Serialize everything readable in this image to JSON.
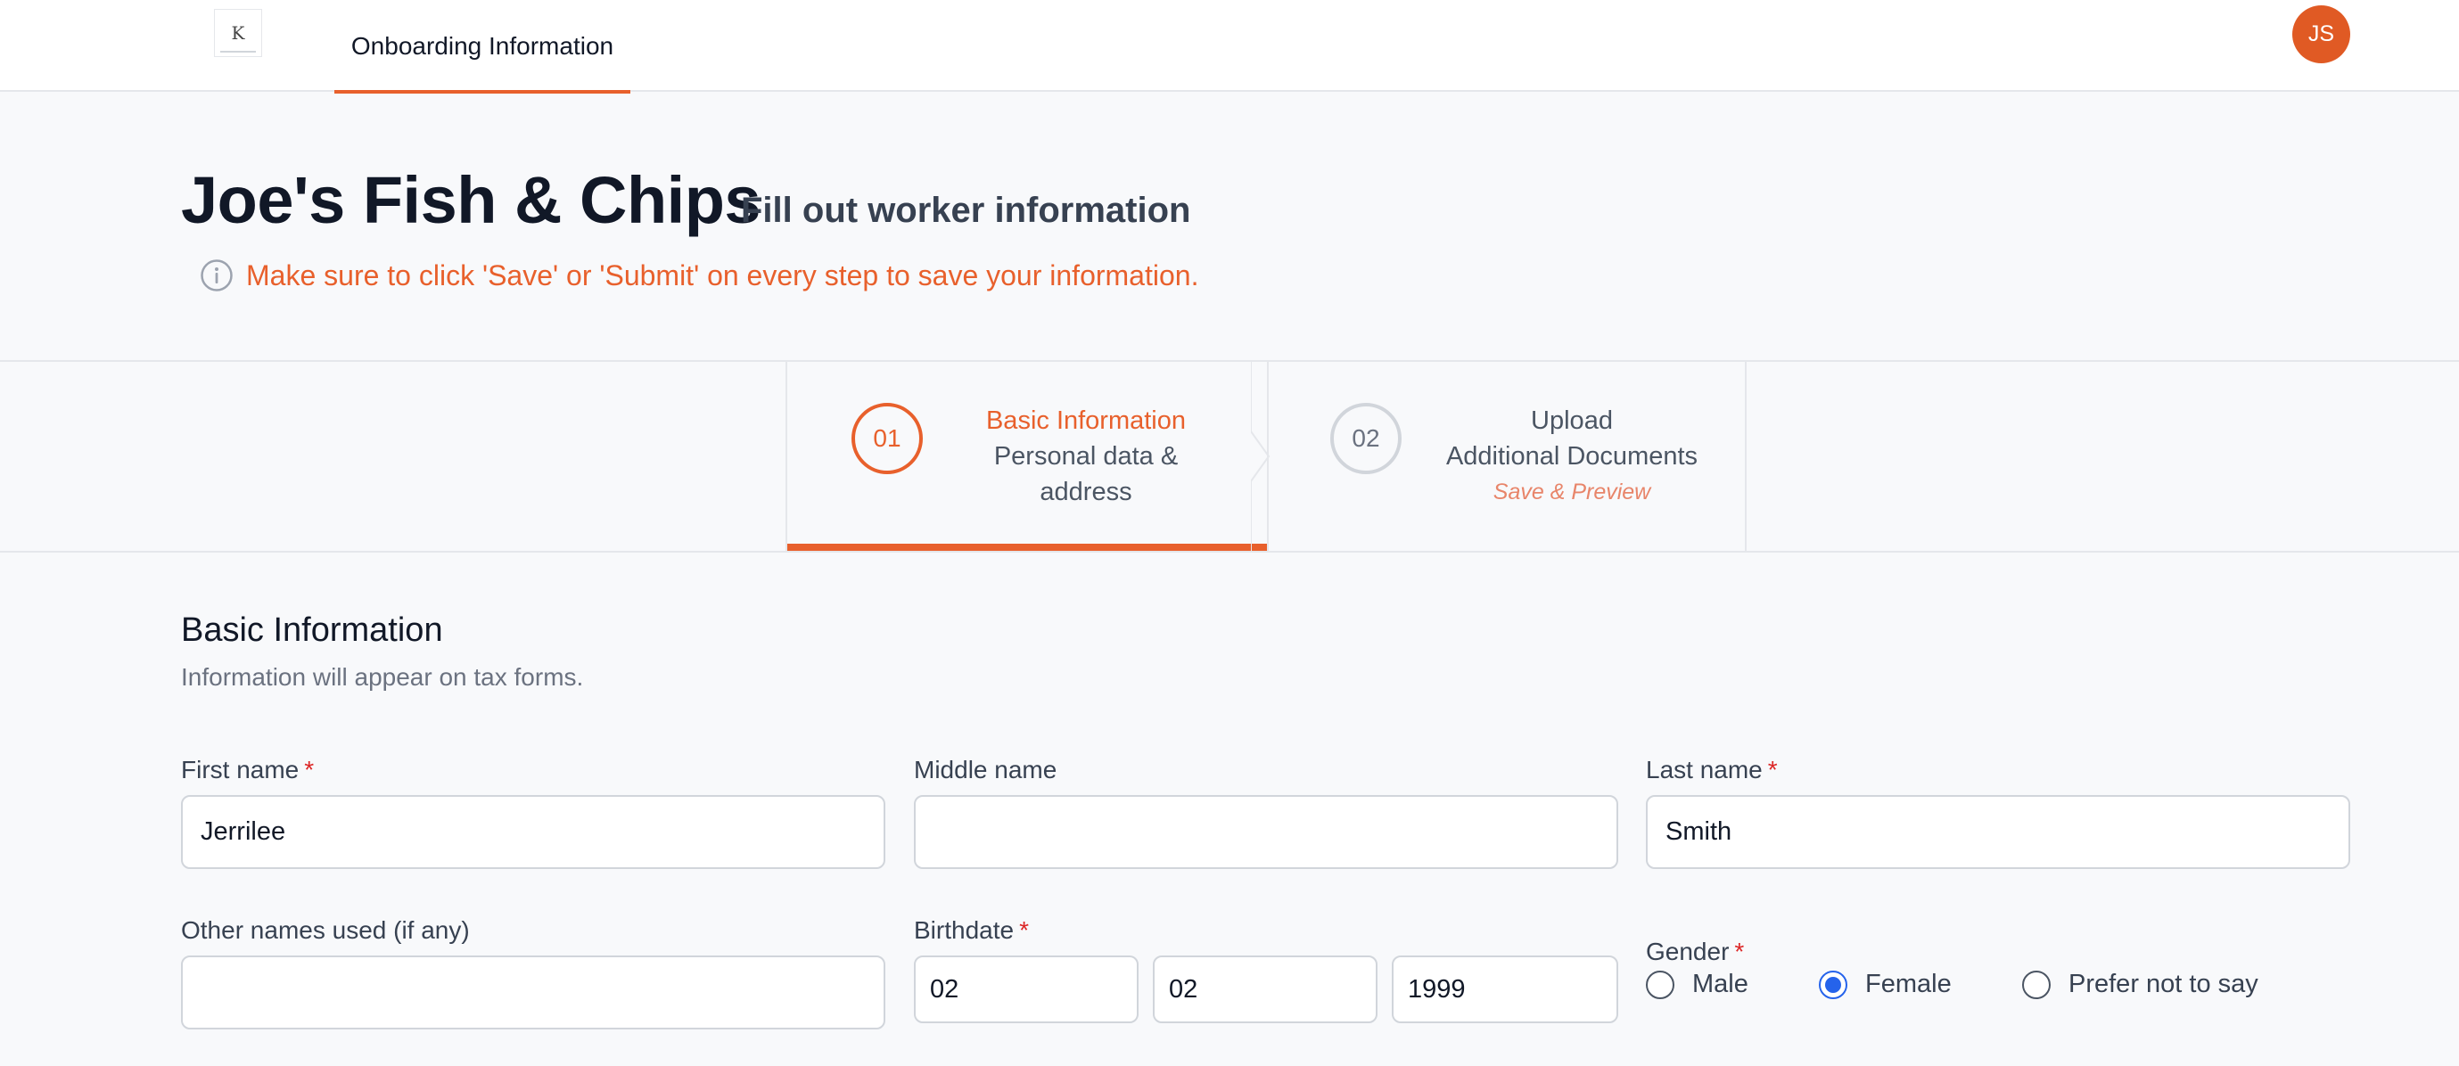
{
  "nav": {
    "logo_letter": "K",
    "tab_label": "Onboarding Information",
    "avatar_initials": "JS"
  },
  "header": {
    "company_name": "Joe's Fish & Chips",
    "subtitle": "Fill out worker information",
    "notice": "Make sure to click 'Save' or 'Submit' on every step to save your information."
  },
  "steps": [
    {
      "number": "01",
      "title": "Basic Information",
      "subtitle": "Personal data & address",
      "active": true
    },
    {
      "number": "02",
      "title": "Upload",
      "subtitle": "Additional Documents",
      "hint": "Save & Preview",
      "active": false
    }
  ],
  "form": {
    "section_title": "Basic Information",
    "section_desc": "Information will appear on tax forms.",
    "required_mark": "*",
    "first_name": {
      "label": "First name",
      "value": "Jerrilee",
      "required": true
    },
    "middle_name": {
      "label": "Middle name",
      "value": "",
      "required": false
    },
    "last_name": {
      "label": "Last name",
      "value": "Smith",
      "required": true
    },
    "other_names": {
      "label": "Other names used (if any)",
      "value": "",
      "required": false
    },
    "birthdate": {
      "label": "Birthdate",
      "month": "02",
      "day": "02",
      "year": "1999",
      "required": true
    },
    "gender": {
      "label": "Gender",
      "required": true,
      "options": [
        "Male",
        "Female",
        "Prefer not to say"
      ],
      "selected": "Female"
    }
  },
  "colors": {
    "accent": "#e8602c",
    "avatar": "#e05a24",
    "radio_selected": "#2563eb",
    "required": "#dc2626"
  }
}
